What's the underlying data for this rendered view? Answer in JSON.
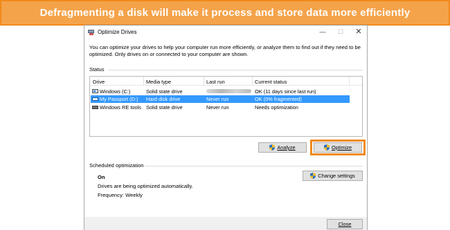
{
  "banner": {
    "text": "Defragmenting a disk will make it process and store data more efficiently"
  },
  "window": {
    "title": "Optimize Drives",
    "controls": {
      "minimize": "—",
      "maximize": "☐",
      "close": "✕"
    }
  },
  "intro": "You can optimize your drives to help your computer run more efficiently, or analyze them to find out if they need to be optimized. Only drives on or connected to your computer are shown.",
  "status_section": {
    "label": "Status",
    "columns": [
      "Drive",
      "Media type",
      "Last run",
      "Current status"
    ],
    "drives": [
      {
        "name": "Windows (C:)",
        "media": "Solid state drive",
        "last_run": "",
        "status": "OK (11 days since last run)",
        "icon": "os-drive-icon"
      },
      {
        "name": "My Passport (D:)",
        "media": "Hard disk drive",
        "last_run": "Never run",
        "status": "OK (0% fragmented)",
        "icon": "hard-drive-icon"
      },
      {
        "name": "Windows RE tools",
        "media": "Solid state drive",
        "last_run": "Never run",
        "status": "Needs optimization",
        "icon": "hard-drive-icon"
      }
    ],
    "selected_index": 1
  },
  "buttons": {
    "analyze": "Analyze",
    "optimize": "Optimize",
    "change_settings": "Change settings",
    "close": "Close"
  },
  "scheduled": {
    "label": "Scheduled optimization",
    "state": "On",
    "description": "Drives are being optimized automatically.",
    "frequency": "Frequency: Weekly"
  },
  "colors": {
    "banner": "#f5a34a",
    "highlight": "#f08a1c",
    "selection": "#3399ff"
  }
}
